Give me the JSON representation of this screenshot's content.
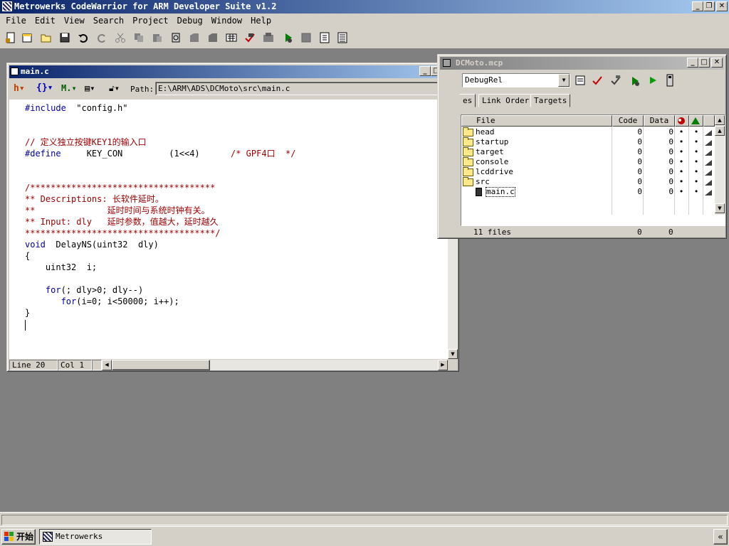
{
  "app": {
    "title": "Metrowerks CodeWarrior for ARM Developer Suite v1.2",
    "menus": [
      "File",
      "Edit",
      "View",
      "Search",
      "Project",
      "Debug",
      "Window",
      "Help"
    ]
  },
  "toolbar_icons": [
    "new-text-file-icon",
    "new-project-icon",
    "open-icon",
    "save-icon",
    "undo-icon",
    "redo-icon",
    "cut-icon",
    "copy-icon",
    "paste-icon",
    "find-icon",
    "find-next-icon",
    "find-in-files-icon",
    "replace-icon",
    "compile-icon",
    "make-icon",
    "precompile-icon",
    "debug-icon",
    "run-icon",
    "stop-icon",
    "disassemble-icon",
    "preprocess-icon"
  ],
  "editor": {
    "title": "main.c",
    "path_label": "Path:",
    "path": "E:\\ARM\\ADS\\DCMoto\\src\\main.c",
    "code": [
      {
        "segments": [
          {
            "t": "#include",
            "c": "kw"
          },
          {
            "t": "  \"config.h\"",
            "c": "cn"
          }
        ]
      },
      {
        "segments": []
      },
      {
        "segments": []
      },
      {
        "segments": [
          {
            "t": "// 定义独立按键KEY1的输入口",
            "c": "cm"
          }
        ]
      },
      {
        "segments": [
          {
            "t": "#define",
            "c": "kw"
          },
          {
            "t": "     KEY_CON         (1<<4)      ",
            "c": "cn"
          },
          {
            "t": "/* GPF4口  */",
            "c": "cm"
          }
        ]
      },
      {
        "segments": []
      },
      {
        "segments": []
      },
      {
        "segments": [
          {
            "t": "/************************************",
            "c": "cm"
          }
        ]
      },
      {
        "segments": [
          {
            "t": "** Descriptions: 长软件延时。",
            "c": "cm"
          }
        ]
      },
      {
        "segments": [
          {
            "t": "**              延时时间与系统时钟有关。",
            "c": "cm"
          }
        ]
      },
      {
        "segments": [
          {
            "t": "** Input: dly   延时参数，值越大，延时越久",
            "c": "cm"
          }
        ]
      },
      {
        "segments": [
          {
            "t": "*************************************/",
            "c": "cm"
          }
        ]
      },
      {
        "segments": [
          {
            "t": "void",
            "c": "kw"
          },
          {
            "t": "  DelayNS(uint32  dly)",
            "c": "cn"
          }
        ]
      },
      {
        "segments": [
          {
            "t": "{",
            "c": "cn"
          }
        ]
      },
      {
        "segments": [
          {
            "t": "    uint32  i;",
            "c": "cn"
          }
        ]
      },
      {
        "segments": []
      },
      {
        "segments": [
          {
            "t": "    ",
            "c": "cn"
          },
          {
            "t": "for",
            "c": "kw"
          },
          {
            "t": "(; dly>0; dly--)",
            "c": "cn"
          }
        ]
      },
      {
        "segments": [
          {
            "t": "       ",
            "c": "cn"
          },
          {
            "t": "for",
            "c": "kw"
          },
          {
            "t": "(i=0; i<50000; i++);",
            "c": "cn"
          }
        ]
      },
      {
        "segments": [
          {
            "t": "}",
            "c": "cn"
          }
        ]
      },
      {
        "segments": []
      }
    ],
    "status": {
      "line": "Line 20",
      "col": "Col 1"
    }
  },
  "project": {
    "title": "DCMoto.mcp",
    "target": "DebugRel",
    "tabs": [
      "es",
      "Link Order",
      "Targets"
    ],
    "columns": {
      "file": "File",
      "code": "Code",
      "data": "Data"
    },
    "rows": [
      {
        "name": "head",
        "type": "folder",
        "code": "0",
        "data": "0"
      },
      {
        "name": "startup",
        "type": "folder",
        "code": "0",
        "data": "0"
      },
      {
        "name": "target",
        "type": "folder",
        "code": "0",
        "data": "0"
      },
      {
        "name": "console",
        "type": "folder",
        "code": "0",
        "data": "0"
      },
      {
        "name": "lcddrive",
        "type": "folder",
        "code": "0",
        "data": "0"
      },
      {
        "name": "src",
        "type": "folder-open",
        "code": "0",
        "data": "0"
      },
      {
        "name": "main.c",
        "type": "file",
        "code": "0",
        "data": "0"
      }
    ],
    "footer": {
      "files": "11 files",
      "code": "0",
      "data": "0"
    }
  },
  "taskbar": {
    "start": "开始",
    "task": "Metrowerks CodeWarr..."
  }
}
